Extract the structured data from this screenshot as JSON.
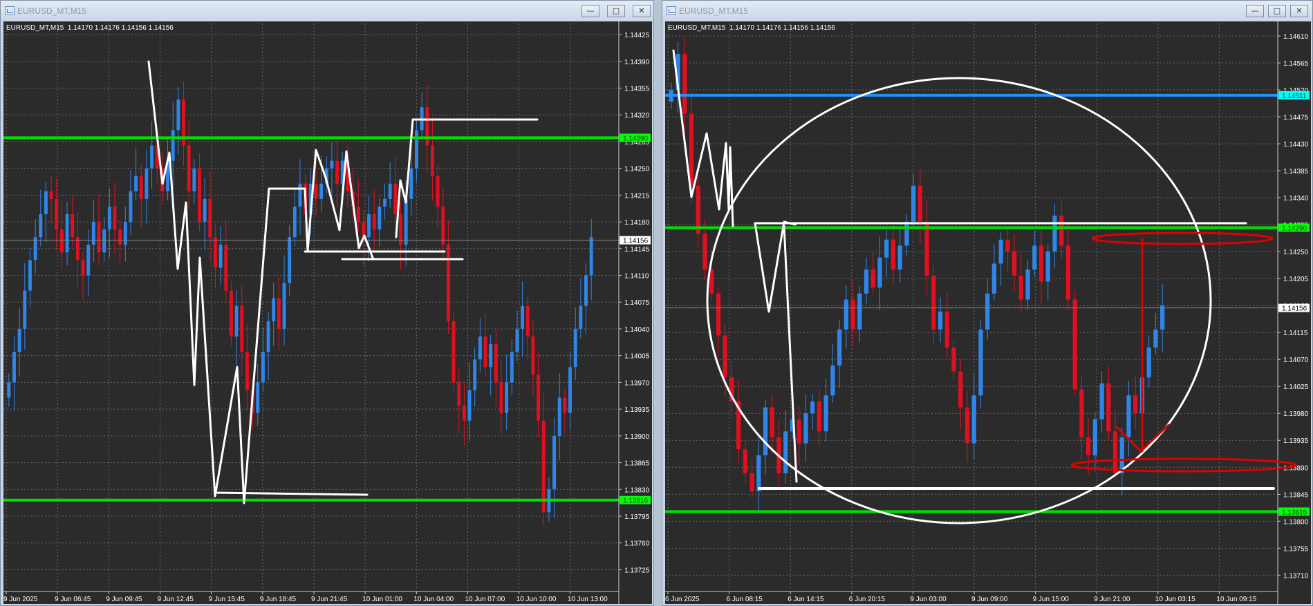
{
  "windows": [
    {
      "id": "left",
      "title": "EURUSD_MT,M15",
      "symbol_line": "EURUSD_MT,M15  1.14170 1.14176 1.14156 1.14156",
      "buttons": {
        "minimize": "—",
        "maximize": "□",
        "close": "✕"
      },
      "chart_data": {
        "type": "candlestick",
        "symbol": "EURUSD_MT",
        "timeframe": "M15",
        "ohlc_last": {
          "open": 1.1417,
          "high": 1.14176,
          "low": 1.14156,
          "close": 1.14156
        },
        "ylim": [
          1.1371,
          1.14435
        ],
        "y_ticks": [
          "1.14425",
          "1.14390",
          "1.14355",
          "1.14320",
          "1.14285",
          "1.14250",
          "1.14215",
          "1.14180",
          "1.14145",
          "1.14110",
          "1.14075",
          "1.14040",
          "1.14005",
          "1.13970",
          "1.13935",
          "1.13900",
          "1.13865",
          "1.13830",
          "1.13795",
          "1.13760",
          "1.13725"
        ],
        "x_ticks": [
          "9 Jun 2025",
          "9 Jun 06:45",
          "9 Jun 09:45",
          "9 Jun 12:45",
          "9 Jun 15:45",
          "9 Jun 18:45",
          "9 Jun 21:45",
          "10 Jun 01:00",
          "10 Jun 04:00",
          "10 Jun 07:00",
          "10 Jun 10:00",
          "10 Jun 13:00"
        ],
        "price_tags": [
          {
            "value": 1.1429,
            "label": "1.14290",
            "color": "#00ff00"
          },
          {
            "value": 1.14156,
            "label": "1.14156",
            "color": "#ffffff"
          },
          {
            "value": 1.13816,
            "label": "1.13816",
            "color": "#00ff00"
          }
        ],
        "levels": [
          {
            "value": 1.1429,
            "color": "#00e000"
          },
          {
            "value": 1.13816,
            "color": "#00e000"
          }
        ],
        "candles_close": [
          1.1397,
          1.1401,
          1.1404,
          1.1409,
          1.1413,
          1.1416,
          1.1419,
          1.1422,
          1.1421,
          1.1417,
          1.1414,
          1.1419,
          1.1416,
          1.1413,
          1.1411,
          1.1415,
          1.1418,
          1.1414,
          1.1417,
          1.142,
          1.1417,
          1.1415,
          1.1418,
          1.1422,
          1.1424,
          1.1421,
          1.1425,
          1.1428,
          1.1425,
          1.1422,
          1.1426,
          1.143,
          1.1434,
          1.1428,
          1.1422,
          1.1425,
          1.1418,
          1.1421,
          1.1416,
          1.1412,
          1.1415,
          1.1409,
          1.1403,
          1.1407,
          1.1401,
          1.1396,
          1.1393,
          1.1397,
          1.1401,
          1.1405,
          1.1408,
          1.1404,
          1.141,
          1.1416,
          1.142,
          1.1423,
          1.1419,
          1.1423,
          1.1421,
          1.1423,
          1.1425,
          1.1426,
          1.1423,
          1.1426,
          1.1422,
          1.142,
          1.1418,
          1.1416,
          1.1419,
          1.1417,
          1.142,
          1.1421,
          1.1423,
          1.1419,
          1.1415,
          1.1421,
          1.1425,
          1.143,
          1.1433,
          1.1428,
          1.1424,
          1.142,
          1.1415,
          1.1405,
          1.1397,
          1.1394,
          1.1392,
          1.1396,
          1.14,
          1.1403,
          1.1399,
          1.1402,
          1.1397,
          1.1393,
          1.1397,
          1.1401,
          1.1404,
          1.1407,
          1.1403,
          1.1398,
          1.1392,
          1.138,
          1.1383,
          1.139,
          1.1395,
          1.1393,
          1.1399,
          1.1404,
          1.1407,
          1.1411,
          1.1416
        ]
      }
    },
    {
      "id": "right",
      "title": "EURUSD_MT,M15",
      "symbol_line": "EURUSD_MT,M15  1.14170 1.14176 1.14156 1.14156",
      "buttons": {
        "minimize": "—",
        "maximize": "□",
        "close": "✕"
      },
      "chart_data": {
        "type": "candlestick",
        "symbol": "EURUSD_MT",
        "timeframe": "M15",
        "ohlc_last": {
          "open": 1.1417,
          "high": 1.14176,
          "low": 1.14156,
          "close": 1.14156
        },
        "ylim": [
          1.137,
          1.14625
        ],
        "y_ticks": [
          "1.14610",
          "1.14565",
          "1.14520",
          "1.14475",
          "1.14430",
          "1.14385",
          "1.14340",
          "1.14295",
          "1.14250",
          "1.14205",
          "1.14160",
          "1.14115",
          "1.14070",
          "1.14025",
          "1.13980",
          "1.13935",
          "1.13890",
          "1.13845",
          "1.13800",
          "1.13755",
          "1.13710"
        ],
        "x_ticks": [
          "6 Jun 2025",
          "6 Jun 08:15",
          "6 Jun 14:15",
          "6 Jun 20:15",
          "9 Jun 03:00",
          "9 Jun 09:00",
          "9 Jun 15:00",
          "9 Jun 21:00",
          "10 Jun 03:15",
          "10 Jun 09:15"
        ],
        "price_tags": [
          {
            "value": 1.14511,
            "label": "1.14511",
            "color": "#00ffff"
          },
          {
            "value": 1.1429,
            "label": "1.14290",
            "color": "#00ff00"
          },
          {
            "value": 1.14156,
            "label": "1.14156",
            "color": "#ffffff"
          },
          {
            "value": 1.13816,
            "label": "1.13816",
            "color": "#00ff00"
          }
        ],
        "levels": [
          {
            "value": 1.14511,
            "color": "#1e90ff"
          },
          {
            "value": 1.1429,
            "color": "#00e000"
          },
          {
            "value": 1.13816,
            "color": "#00e000"
          }
        ],
        "candles_close": [
          1.1452,
          1.1458,
          1.1448,
          1.1436,
          1.1428,
          1.1422,
          1.1418,
          1.1411,
          1.1404,
          1.14,
          1.1392,
          1.1388,
          1.1385,
          1.1391,
          1.1399,
          1.1394,
          1.1388,
          1.1395,
          1.1397,
          1.1393,
          1.1398,
          1.14,
          1.1395,
          1.1401,
          1.1406,
          1.1412,
          1.1417,
          1.1412,
          1.1418,
          1.1422,
          1.1419,
          1.1424,
          1.1427,
          1.1422,
          1.1426,
          1.143,
          1.1436,
          1.143,
          1.1421,
          1.1412,
          1.1415,
          1.1409,
          1.1405,
          1.1399,
          1.1393,
          1.1401,
          1.1412,
          1.1418,
          1.1423,
          1.1427,
          1.1425,
          1.1421,
          1.1417,
          1.1422,
          1.1426,
          1.142,
          1.1425,
          1.1431,
          1.1426,
          1.1417,
          1.1402,
          1.1394,
          1.1391,
          1.1397,
          1.1403,
          1.1395,
          1.1388,
          1.1394,
          1.1401,
          1.1398,
          1.1404,
          1.1409,
          1.1412,
          1.1416
        ]
      }
    }
  ]
}
